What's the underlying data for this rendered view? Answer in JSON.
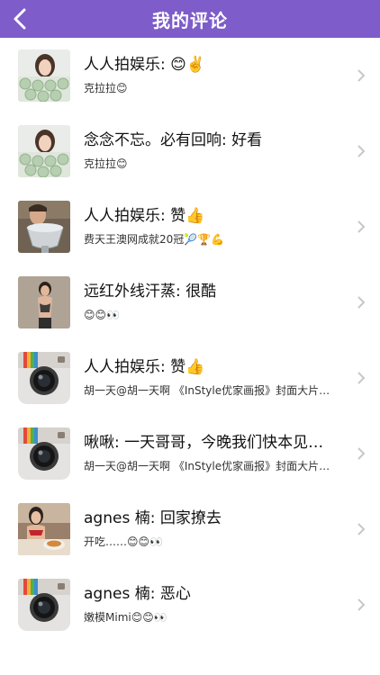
{
  "header": {
    "title": "我的评论",
    "back_icon": "chevron-left-icon"
  },
  "colors": {
    "nav_bg": "#7e5cc9",
    "chevron": "#c7c7cc"
  },
  "comments": [
    {
      "title": "人人拍娱乐: 😊✌️",
      "subtitle": "克拉拉😊",
      "thumb": "photo-girl-cupcakes"
    },
    {
      "title": "念念不忘。必有回响: 好看",
      "subtitle": "克拉拉😊",
      "thumb": "photo-girl-cupcakes"
    },
    {
      "title": "人人拍娱乐: 赞👍",
      "subtitle": "费天王澳网成就20冠🎾🏆💪",
      "thumb": "photo-trophy"
    },
    {
      "title": "远红外线汗蒸: 很酷",
      "subtitle": "😊😊👀",
      "thumb": "photo-woman-tattoo"
    },
    {
      "title": "人人拍娱乐: 赞👍",
      "subtitle": "胡一天@胡一天啊 《InStyle优家画报》封面大片…",
      "thumb": "instagram-camera-icon"
    },
    {
      "title": "啾啾: 一天哥哥，今晚我们快本见…",
      "subtitle": "胡一天@胡一天啊 《InStyle优家画报》封面大片…",
      "thumb": "instagram-camera-icon"
    },
    {
      "title": "agnes 楠: 回家撩去",
      "subtitle": "开吃……😊😊👀",
      "thumb": "photo-woman-food"
    },
    {
      "title": "agnes 楠: 恶心",
      "subtitle": "嫩模Mimi😊😊👀",
      "thumb": "instagram-camera-icon"
    }
  ]
}
